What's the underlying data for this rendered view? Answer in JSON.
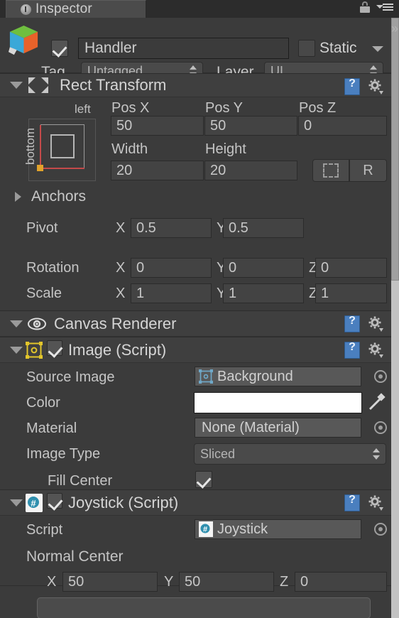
{
  "window": {
    "tab_label": "Inspector",
    "tab_icon": "info-circle-icon",
    "lock_icon": "lock-icon",
    "menu_icon": "hamburger-menu-icon",
    "expand_icon": "chevron-right-icon"
  },
  "gameobject": {
    "icon": "cube-icon",
    "enabled_checkbox": true,
    "name": "Handler",
    "static_label": "Static",
    "static_checked": false,
    "static_dropdown_icon": "chevron-down-icon",
    "tag_label": "Tag",
    "tag_value": "Untagged",
    "layer_label": "Layer",
    "layer_value": "UI"
  },
  "components": [
    {
      "id": "rect-transform",
      "title": "Rect Transform",
      "icon": "rect-transform-icon",
      "expanded": true,
      "help_icon": "help-book-icon",
      "gear_icon": "gear-icon",
      "anchor_preview": {
        "horizontal_label": "left",
        "vertical_label": "bottom"
      },
      "fields": {
        "pos_x_label": "Pos X",
        "pos_x": "50",
        "pos_y_label": "Pos Y",
        "pos_y": "50",
        "pos_z_label": "Pos Z",
        "pos_z": "0",
        "width_label": "Width",
        "width": "20",
        "height_label": "Height",
        "height": "20",
        "blueprint_icon": "blueprint-mode-icon",
        "raw_label": "R",
        "anchors_label": "Anchors",
        "anchors_expanded": false,
        "pivot_label": "Pivot",
        "pivot_x_axis": "X",
        "pivot_x": "0.5",
        "pivot_y_axis": "Y",
        "pivot_y": "0.5",
        "rotation_label": "Rotation",
        "rotation_x_axis": "X",
        "rotation_x": "0",
        "rotation_y_axis": "Y",
        "rotation_y": "0",
        "rotation_z_axis": "Z",
        "rotation_z": "0",
        "scale_label": "Scale",
        "scale_x_axis": "X",
        "scale_x": "1",
        "scale_y_axis": "Y",
        "scale_y": "1",
        "scale_z_axis": "Z",
        "scale_z": "1"
      }
    },
    {
      "id": "canvas-renderer",
      "title": "Canvas Renderer",
      "icon": "eye-icon",
      "expanded": true,
      "help_icon": "help-book-icon",
      "gear_icon": "gear-icon"
    },
    {
      "id": "image-script",
      "title": "Image (Script)",
      "icon": "sprite-icon",
      "expanded": true,
      "enabled_checkbox": true,
      "help_icon": "help-book-icon",
      "gear_icon": "gear-icon",
      "fields": {
        "source_image_label": "Source Image",
        "source_image_value": "Background",
        "source_image_icon": "sprite-thumbnail-icon",
        "source_image_picker_icon": "object-picker-icon",
        "color_label": "Color",
        "color_value": "#FFFFFF",
        "eyedropper_icon": "eyedropper-icon",
        "material_label": "Material",
        "material_value": "None (Material)",
        "material_picker_icon": "object-picker-icon",
        "image_type_label": "Image Type",
        "image_type_value": "Sliced",
        "fill_center_label": "Fill Center",
        "fill_center_checked": true
      }
    },
    {
      "id": "joystick-script",
      "title": "Joystick (Script)",
      "icon": "csharp-script-icon",
      "expanded": true,
      "enabled_checkbox": true,
      "help_icon": "help-book-icon",
      "gear_icon": "gear-icon",
      "fields": {
        "script_label": "Script",
        "script_value": "Joystick",
        "script_icon": "csharp-script-icon",
        "script_picker_icon": "object-picker-icon",
        "normal_center_label": "Normal Center",
        "nc_x_axis": "X",
        "nc_x": "50",
        "nc_y_axis": "Y",
        "nc_y": "50",
        "nc_z_axis": "Z",
        "nc_z": "0"
      }
    }
  ],
  "colors": {
    "panel_bg": "#3b3b3b",
    "header_bg": "#3f3f3f",
    "field_bg": "#434343",
    "accent_blue": "#4a7fbf",
    "pivot_orange": "#e2a32b",
    "anchor_red": "#c44a4a"
  }
}
